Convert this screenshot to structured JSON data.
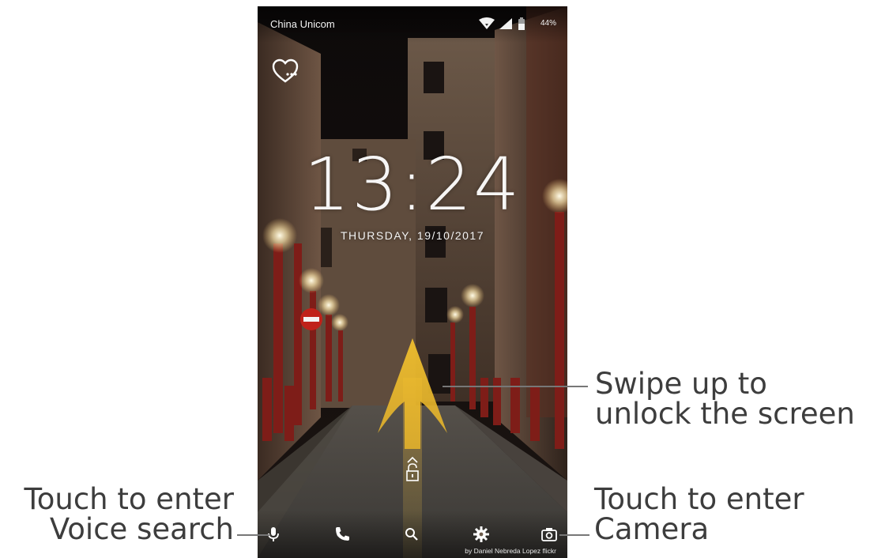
{
  "status_bar": {
    "carrier": "China Unicom",
    "battery": "44%"
  },
  "lock_screen": {
    "time": "13:24",
    "date": "THURSDAY, 19/10/2017",
    "photo_credit": "by Daniel Nebreda Lopez flickr"
  },
  "icons": {
    "favorite": "heart-icon",
    "voice": "microphone-icon",
    "phone": "phone-icon",
    "search": "search-icon",
    "settings": "gear-icon",
    "camera": "camera-icon",
    "unlock": "padlock-icon"
  },
  "annotations": {
    "swipe_line1": "Swipe up to",
    "swipe_line2": "unlock the screen",
    "voice_line1": "Touch to enter",
    "voice_line2": "Voice search",
    "camera_line1": "Touch to enter",
    "camera_line2": "Camera"
  },
  "colors": {
    "arrow": "#e8b52a",
    "annotation_text": "#3d3d3d"
  }
}
